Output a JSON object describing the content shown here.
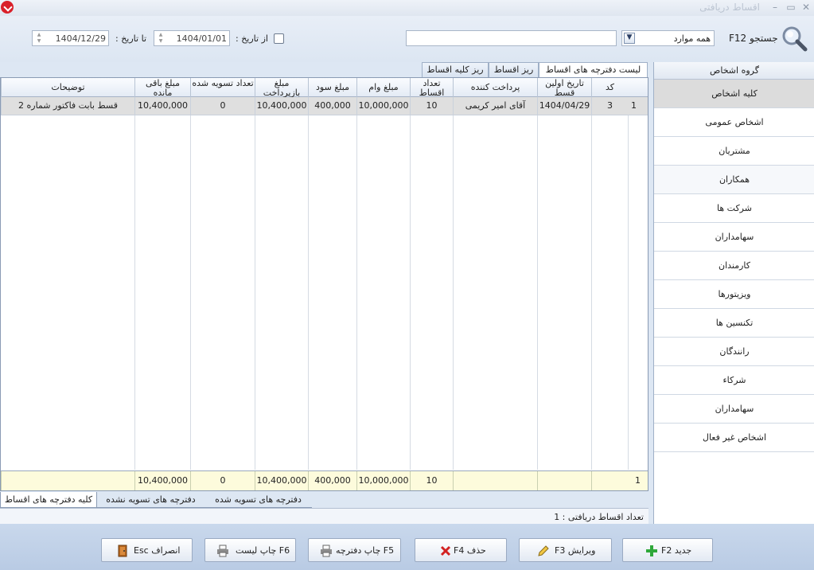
{
  "window": {
    "title": "اقساط دریافتی",
    "minimize": "–",
    "maximize": "▭",
    "close": "✕"
  },
  "search": {
    "label": "جستجو F12",
    "scope_value": "همه موارد",
    "query": ""
  },
  "date_filter": {
    "from_label": "از تاریخ :",
    "from_value": "1404/01/01",
    "to_label": "تا تاریخ :",
    "to_value": "1404/12/29"
  },
  "tabs": [
    {
      "label": "لیست دفترچه های اقساط"
    },
    {
      "label": "ریز اقساط"
    },
    {
      "label": "ریز کلیه اقساط"
    }
  ],
  "grid": {
    "headers": {
      "code": "کد",
      "first_date": "تاریخ اولین قسط",
      "payer": "پرداخت کننده",
      "count": "تعداد اقساط",
      "loan": "مبلغ وام",
      "profit": "مبلغ سود",
      "repay": "مبلغ بازپرداخت",
      "settled": "تعداد تسویه شده",
      "remaining": "مبلغ باقی مانده",
      "notes": "توضیحات"
    },
    "row": {
      "index": "1",
      "code": "3",
      "first_date": "1404/04/29",
      "payer": "آقای امیر کریمی",
      "count": "10",
      "loan": "10,000,000",
      "profit": "400,000",
      "repay": "10,400,000",
      "settled": "0",
      "remaining": "10,400,000",
      "notes": "قسط بابت فاکتور شماره 2"
    },
    "footer": {
      "index": "1",
      "count": "10",
      "loan": "10,000,000",
      "profit": "400,000",
      "repay": "10,400,000",
      "settled": "0",
      "remaining": "10,400,000"
    }
  },
  "bottom_tabs": [
    {
      "label": "کلیه دفترچه های اقساط"
    },
    {
      "label": "دفترچه های تسویه نشده"
    },
    {
      "label": "دفترچه های تسویه شده"
    }
  ],
  "status": {
    "text": "تعداد اقساط دریافتی : 1"
  },
  "sidebar": {
    "header": "گروه اشخاص",
    "items": [
      "کلیه اشخاص",
      "اشخاص عمومی",
      "مشتریان",
      "همکاران",
      "شرکت ها",
      "سهامداران",
      "کارمندان",
      "ویزیتورها",
      "تکنسین ها",
      "رانندگان",
      "شرکاء",
      "سهامداران",
      "اشخاص غیر فعال"
    ]
  },
  "buttons": {
    "new": "جدید F2",
    "edit": "ویرایش F3",
    "delete": "حذف F4",
    "print_book": "F5 چاپ دفترچه",
    "print_list": "F6 چاپ لیست",
    "cancel": "انصراف Esc"
  },
  "colors": {
    "accent_red": "#d9202a",
    "selected_row": "#dfdfdf",
    "footer_bg": "#fdfbdc"
  }
}
